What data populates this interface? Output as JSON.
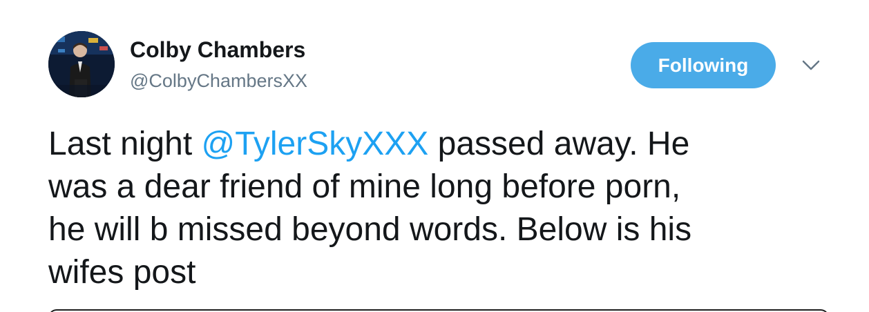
{
  "tweet": {
    "author": {
      "display_name": "Colby Chambers",
      "handle": "@ColbyChambersXX",
      "avatar": "avatar-photo"
    },
    "follow_button_label": "Following",
    "menu_icon": "chevron-down-icon",
    "text_lines": [
      {
        "before": "Last night ",
        "mention": "@TylerSkyXXX",
        "after": " passed away. He"
      },
      {
        "text": "was a dear friend of mine long before porn,"
      },
      {
        "text": "he will b missed beyond words. Below is his"
      },
      {
        "text": "wifes post"
      }
    ]
  },
  "colors": {
    "accent": "#1da1f2",
    "button": "#4aabe8",
    "secondary_text": "#657786",
    "primary_text": "#14171a"
  }
}
